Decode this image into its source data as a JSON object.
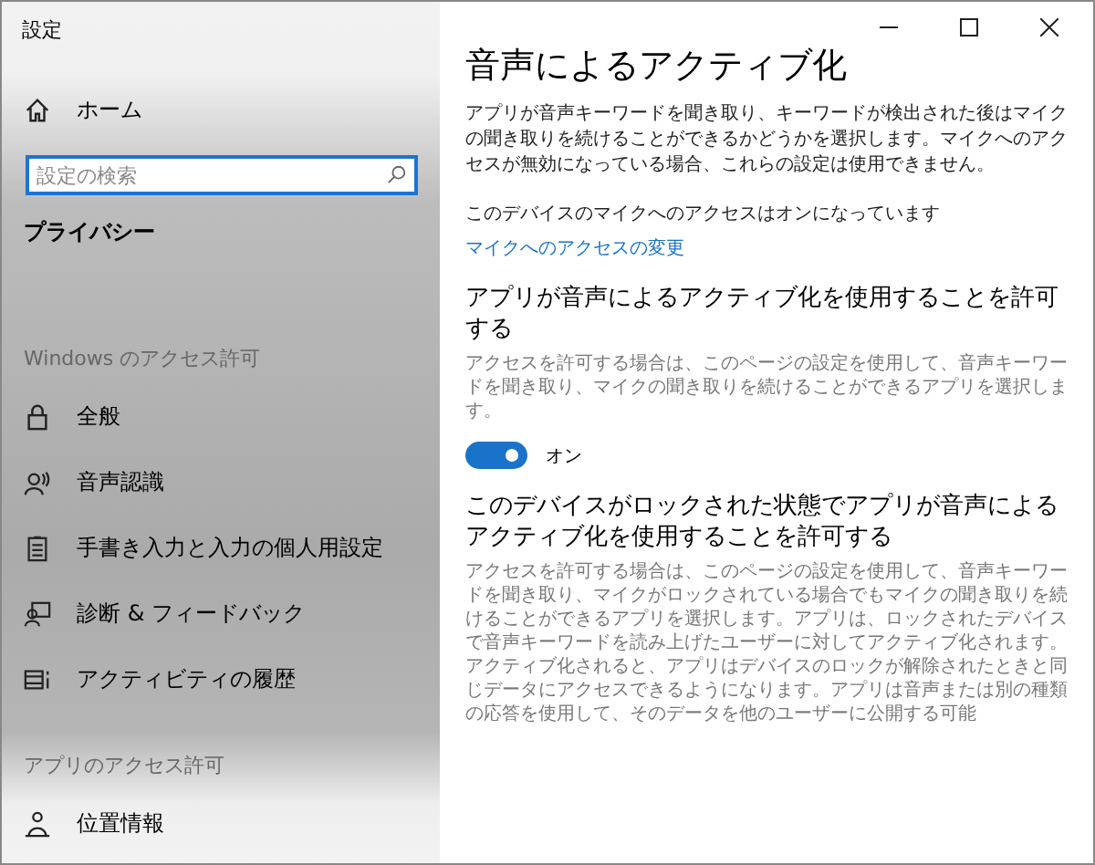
{
  "window": {
    "title": "設定"
  },
  "sidebar": {
    "home": "ホーム",
    "search": {
      "placeholder": "設定の検索"
    },
    "heading": "プライバシー",
    "sections": [
      {
        "title": "Windows のアクセス許可",
        "items": [
          {
            "label": "全般"
          },
          {
            "label": "音声認識"
          },
          {
            "label": "手書き入力と入力の個人用設定"
          },
          {
            "label": "診断 & フィードバック"
          },
          {
            "label": "アクティビティの履歴"
          }
        ]
      },
      {
        "title": "アプリのアクセス許可",
        "items": [
          {
            "label": "位置情報"
          }
        ]
      }
    ]
  },
  "content": {
    "title": "音声によるアクティブ化",
    "intro": "アプリが音声キーワードを聞き取り、キーワードが検出された後はマイクの聞き取りを続けることができるかどうかを選択します。マイクへのアクセスが無効になっている場合、これらの設定は使用できません。",
    "status": "このデバイスのマイクへのアクセスはオンになっています",
    "link": "マイクへのアクセスの変更",
    "sections": [
      {
        "heading": "アプリが音声によるアクティブ化を使用することを許可する",
        "description": "アクセスを許可する場合は、このページの設定を使用して、音声キーワードを聞き取り、マイクの聞き取りを続けることができるアプリを選択します。",
        "toggle": {
          "on": true,
          "label": "オン"
        }
      },
      {
        "heading": "このデバイスがロックされた状態でアプリが音声によるアクティブ化を使用することを許可する",
        "description": "アクセスを許可する場合は、このページの設定を使用して、音声キーワードを聞き取り、マイクがロックされている場合でもマイクの聞き取りを続けることができるアプリを選択します。アプリは、ロックされたデバイスで音声キーワードを読み上げたユーザーに対してアクティブ化されます。アクティブ化されると、アプリはデバイスのロックが解除されたときと同じデータにアクセスできるようになります。アプリは音声または別の種類の応答を使用して、そのデータを他のユーザーに公開する可能"
      }
    ]
  }
}
